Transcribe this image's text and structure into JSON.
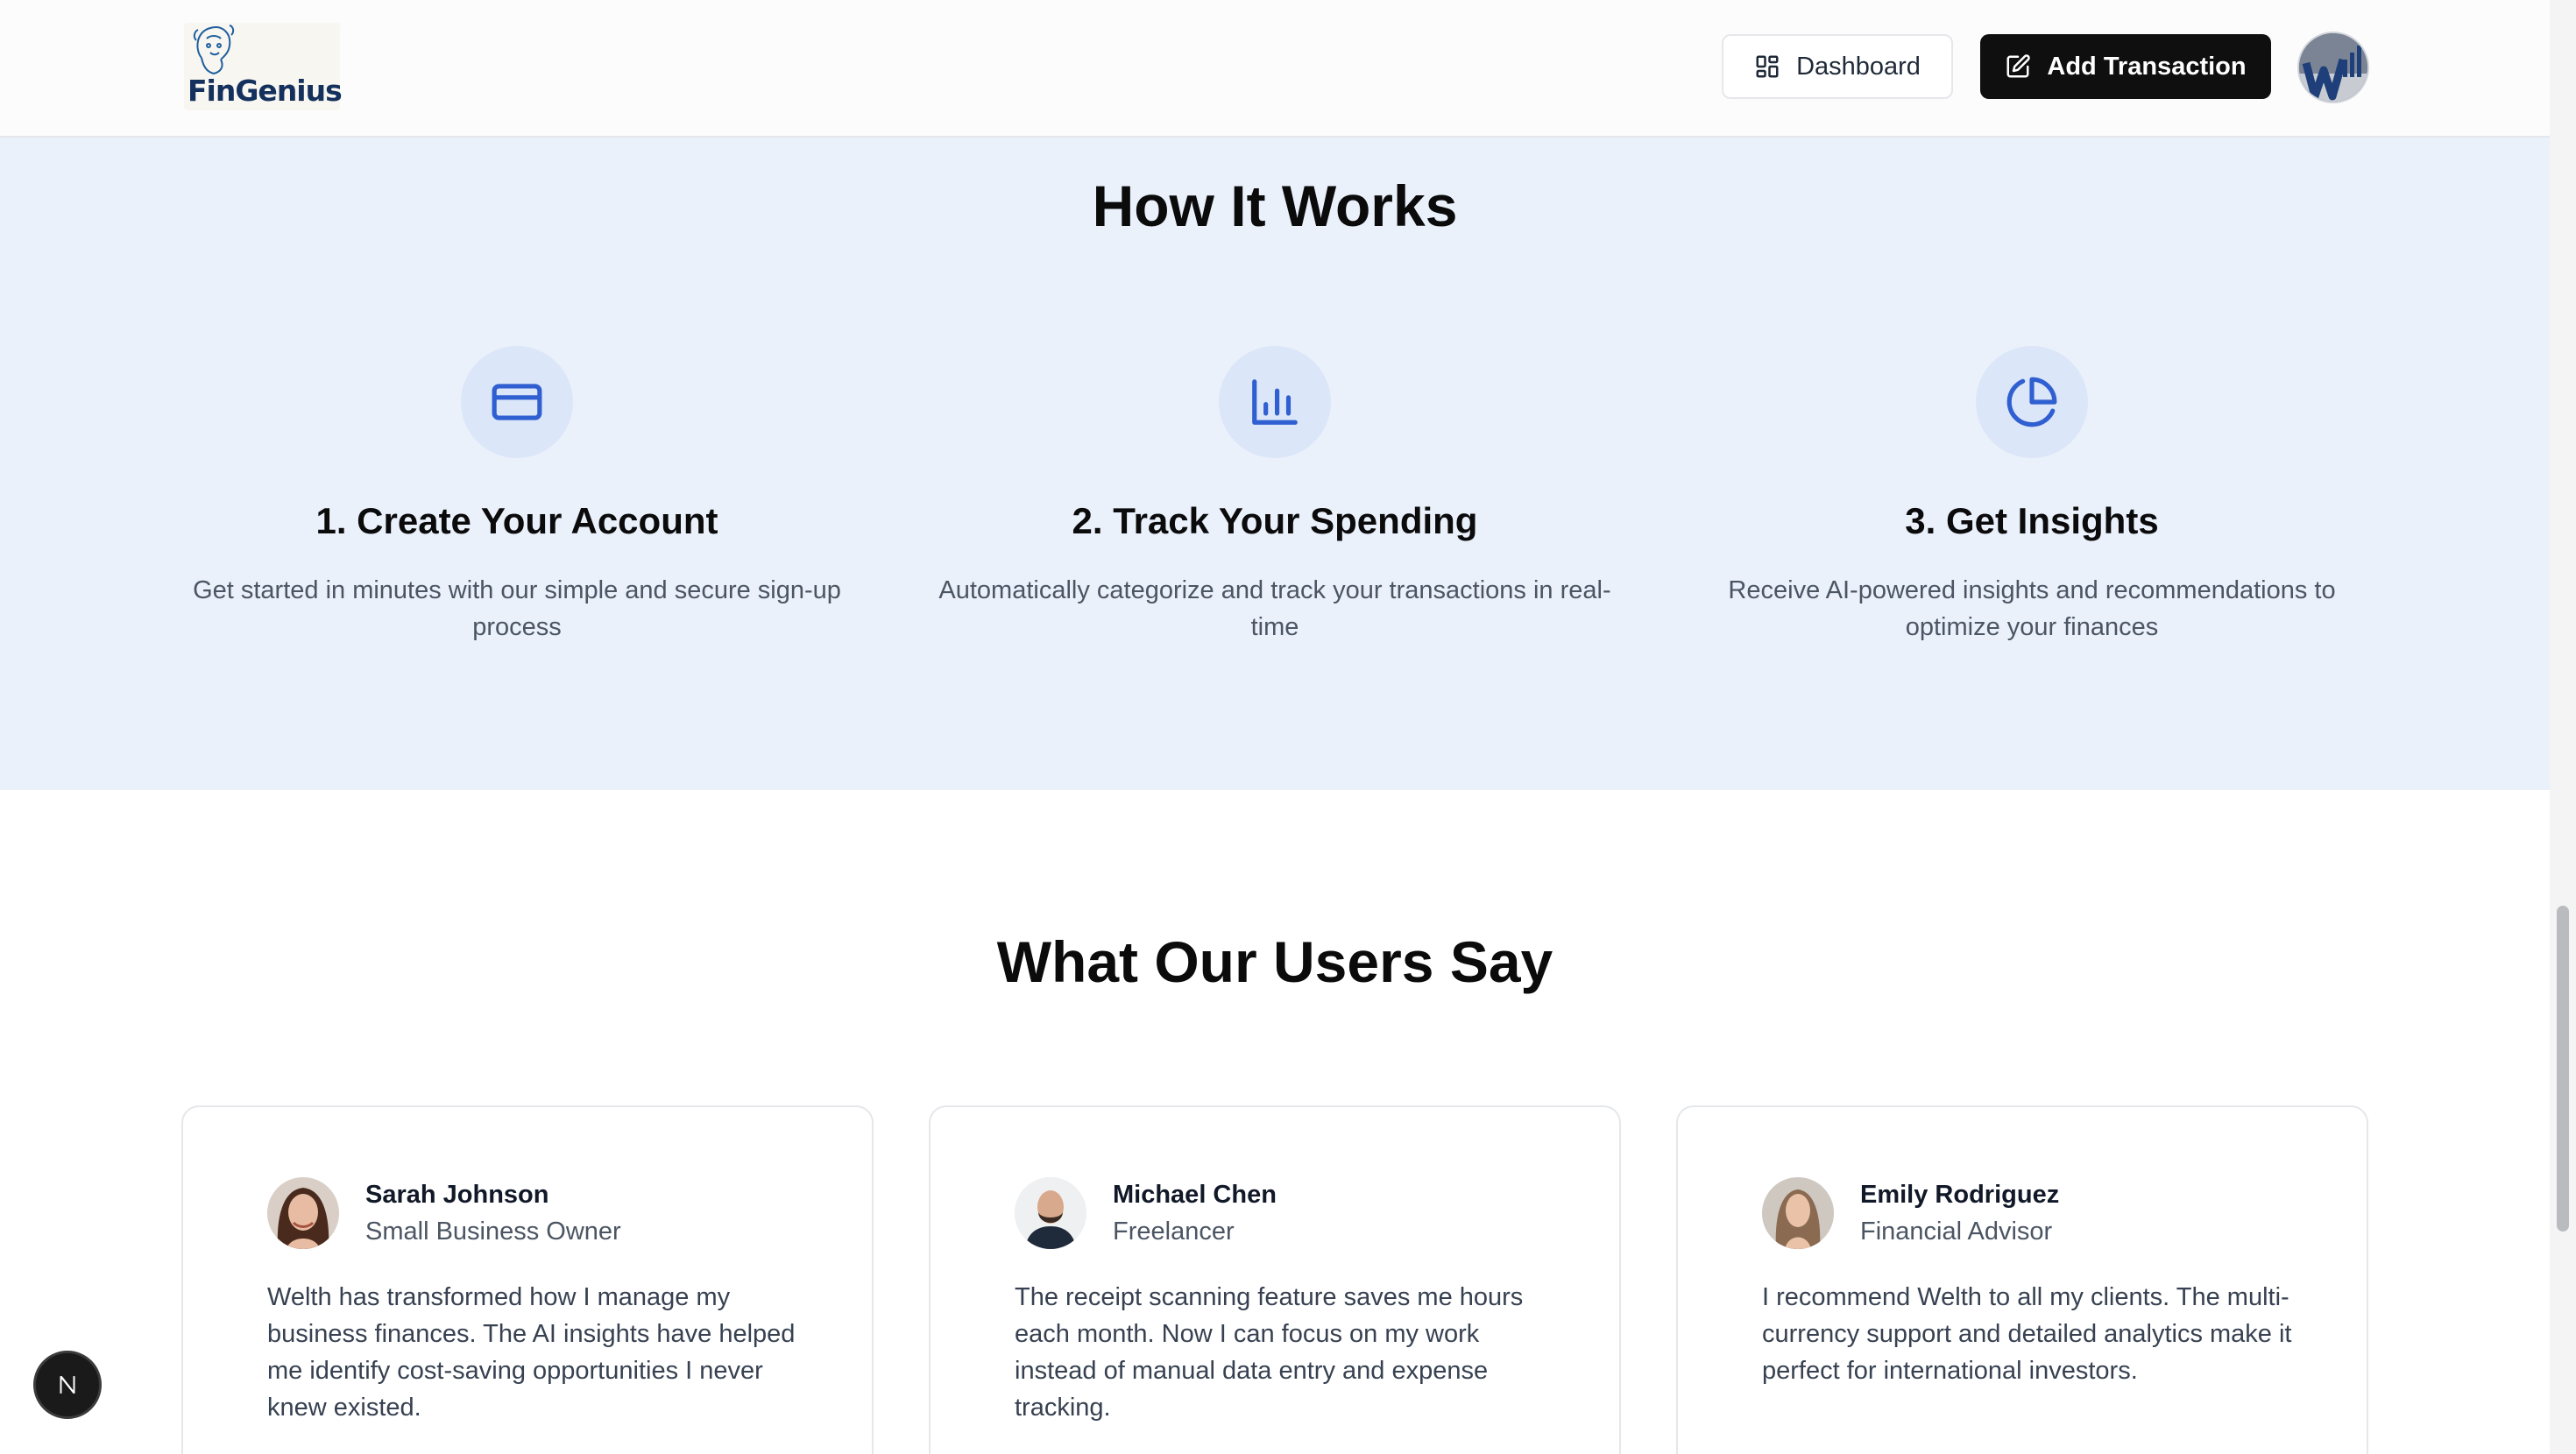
{
  "header": {
    "logo_text": "FinGenius",
    "dashboard_label": "Dashboard",
    "add_transaction_label": "Add Transaction"
  },
  "how_it_works": {
    "title": "How It Works",
    "steps": [
      {
        "icon": "credit-card-icon",
        "title": "1. Create Your Account",
        "text": "Get started in minutes with our simple and secure sign-up process"
      },
      {
        "icon": "bar-chart-icon",
        "title": "2. Track Your Spending",
        "text": "Automatically categorize and track your transactions in real-time"
      },
      {
        "icon": "pie-chart-icon",
        "title": "3. Get Insights",
        "text": "Receive AI-powered insights and recommendations to optimize your finances"
      }
    ]
  },
  "testimonials": {
    "title": "What Our Users Say",
    "items": [
      {
        "name": "Sarah Johnson",
        "role": "Small Business Owner",
        "quote": "Welth has transformed how I manage my business finances. The AI insights have helped me identify cost-saving opportunities I never knew existed."
      },
      {
        "name": "Michael Chen",
        "role": "Freelancer",
        "quote": "The receipt scanning feature saves me hours each month. Now I can focus on my work instead of manual data entry and expense tracking."
      },
      {
        "name": "Emily Rodriguez",
        "role": "Financial Advisor",
        "quote": "I recommend Welth to all my clients. The multi-currency support and detailed analytics make it perfect for international investors."
      }
    ]
  },
  "colors": {
    "accent_blue": "#2f5fd0",
    "section_bg": "#eaf1fb",
    "icon_circle_bg": "#dbe6f8",
    "primary_button": "#0f0f10"
  }
}
